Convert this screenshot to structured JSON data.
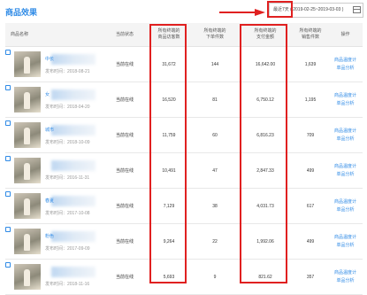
{
  "title": "商品效果",
  "date_picker": {
    "preset": "最近7天",
    "range": "( 2019-02-25~2019-03-03 )"
  },
  "columns": [
    {
      "id": "product",
      "label": "商品名称"
    },
    {
      "id": "status",
      "label": "当前状态"
    },
    {
      "id": "visitors",
      "label_top": "所有终端的",
      "label_bottom": "商品访客数"
    },
    {
      "id": "orders",
      "label_top": "所有终端的",
      "label_bottom": "下单件数"
    },
    {
      "id": "paid",
      "label_top": "所有终端的",
      "label_bottom": "支付金额"
    },
    {
      "id": "sold",
      "label_top": "所有终端的",
      "label_bottom": "销售件数"
    },
    {
      "id": "ops",
      "label": "操作"
    }
  ],
  "rows": [
    {
      "name_prefix": "中长",
      "time": "发布时间：2018-08-21",
      "status": "当前在线",
      "visitors": "31,672",
      "orders": "144",
      "paid": "16,642.00",
      "sold": "1,639",
      "op1": "商品温度计",
      "op2": "单品分析"
    },
    {
      "name_prefix": "女",
      "time": "发布时间：2018-04-20",
      "status": "当前在线",
      "visitors": "16,520",
      "orders": "81",
      "paid": "6,750.12",
      "sold": "1,195",
      "op1": "商品温度计",
      "op2": "单品分析"
    },
    {
      "name_prefix": "城市",
      "time": "发布时间：2018-10-09",
      "status": "当前在线",
      "visitors": "11,759",
      "orders": "60",
      "paid": "6,816.23",
      "sold": "709",
      "op1": "商品温度计",
      "op2": "单品分析"
    },
    {
      "name_prefix": "",
      "time": "发布时间：2016-11-31",
      "status": "当前在线",
      "visitors": "10,491",
      "orders": "47",
      "paid": "2,847.33",
      "sold": "499",
      "op1": "商品温度计",
      "op2": "单品分析"
    },
    {
      "name_prefix": "春夏",
      "time": "发布时间：2017-10-08",
      "status": "当前在线",
      "visitors": "7,129",
      "orders": "38",
      "paid": "4,031.73",
      "sold": "617",
      "op1": "商品温度计",
      "op2": "单品分析"
    },
    {
      "name_prefix": "粉色",
      "time": "发布时间：2017-09-09",
      "status": "当前在线",
      "visitors": "9,264",
      "orders": "22",
      "paid": "1,992.06",
      "sold": "499",
      "op1": "商品温度计",
      "op2": "单品分析"
    },
    {
      "name_prefix": "",
      "time": "发布时间：2018-11-16",
      "status": "当前在线",
      "visitors": "5,693",
      "orders": "9",
      "paid": "821.62",
      "sold": "357",
      "op1": "商品温度计",
      "op2": "单品分析"
    }
  ]
}
